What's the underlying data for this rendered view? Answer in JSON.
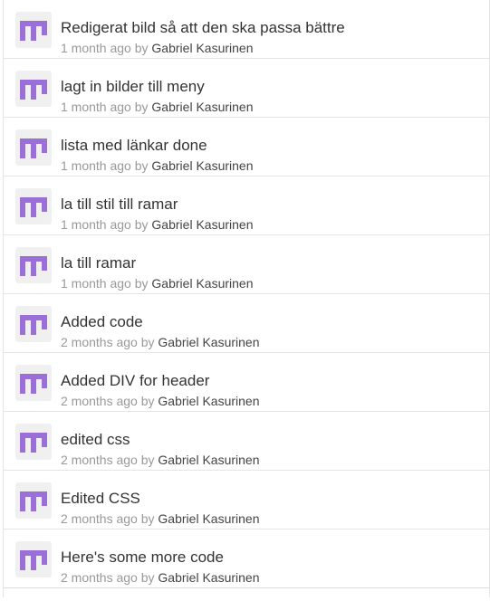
{
  "by_word": "by",
  "commits": [
    {
      "message": "Redigerat bild så att den ska passa bättre",
      "time": "1 month ago",
      "author": "Gabriel Kasurinen"
    },
    {
      "message": "lagt in bilder till meny",
      "time": "1 month ago",
      "author": "Gabriel Kasurinen"
    },
    {
      "message": "lista med länkar done",
      "time": "1 month ago",
      "author": "Gabriel Kasurinen"
    },
    {
      "message": "la till stil till ramar",
      "time": "1 month ago",
      "author": "Gabriel Kasurinen"
    },
    {
      "message": "la till ramar",
      "time": "1 month ago",
      "author": "Gabriel Kasurinen"
    },
    {
      "message": "Added code",
      "time": "2 months ago",
      "author": "Gabriel Kasurinen"
    },
    {
      "message": "Added DIV for header",
      "time": "2 months ago",
      "author": "Gabriel Kasurinen"
    },
    {
      "message": "edited css",
      "time": "2 months ago",
      "author": "Gabriel Kasurinen"
    },
    {
      "message": "Edited CSS",
      "time": "2 months ago",
      "author": "Gabriel Kasurinen"
    },
    {
      "message": "Here's some more code",
      "time": "2 months ago",
      "author": "Gabriel Kasurinen"
    }
  ],
  "colors": {
    "avatar_fg": "#9b6fd8",
    "avatar_bg": "#f0f0f0"
  },
  "icons": {
    "avatar": "identicon-avatar-icon"
  }
}
